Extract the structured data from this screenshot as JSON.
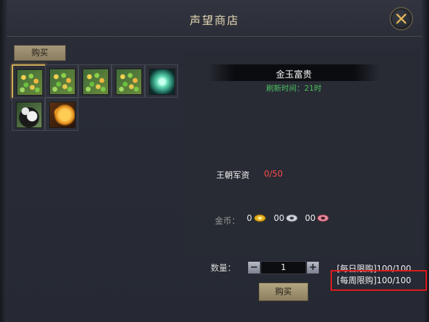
{
  "window": {
    "title": "声望商店"
  },
  "tabs": {
    "buy_label": "购买"
  },
  "grid": {
    "items": [
      {
        "type": "coins",
        "selected": true
      },
      {
        "type": "coins",
        "selected": false
      },
      {
        "type": "coins",
        "selected": false
      },
      {
        "type": "coins",
        "selected": false
      },
      {
        "type": "jade",
        "selected": false
      },
      {
        "type": "panda",
        "selected": false
      },
      {
        "type": "tiger",
        "selected": false
      }
    ]
  },
  "detail": {
    "item_name": "金玉富贵",
    "refresh_label": "刷新时间：",
    "refresh_time": "21时",
    "cost_label": "王朝军资",
    "cost_value": "0/50",
    "coin_label": "金币：",
    "gold_amount": "0",
    "silver_amount": "00",
    "copper_amount": "00"
  },
  "purchase": {
    "quantity_label": "数量：",
    "minus_label": "−",
    "plus_label": "+",
    "quantity_value": "1",
    "daily_limit": "[每日限购]100/100",
    "weekly_limit": "[每周限购]100/100",
    "buy_label": "购买"
  },
  "colors": {
    "gold_text": "#e7d7b4",
    "green_text": "#4cc060",
    "red_text": "#ff4a4a",
    "highlight": "#e21b1b"
  }
}
